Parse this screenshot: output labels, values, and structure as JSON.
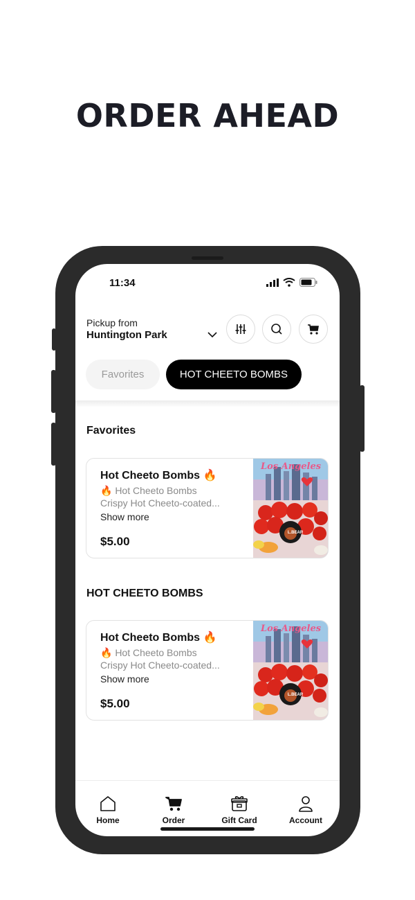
{
  "headline": "ORDER AHEAD",
  "status_bar": {
    "time": "11:34"
  },
  "header": {
    "pickup_label": "Pickup from",
    "location": "Huntington Park",
    "icons": [
      "filter-icon",
      "search-icon",
      "cart-icon"
    ]
  },
  "tabs": [
    {
      "label": "Favorites",
      "active": false
    },
    {
      "label": "HOT CHEETO BOMBS",
      "active": true
    }
  ],
  "sections": [
    {
      "title": "Favorites",
      "item": {
        "name": "Hot Cheeto Bombs 🔥",
        "subtitle": "🔥 Hot Cheeto Bombs",
        "description": "Crispy Hot Cheeto-coated...",
        "show_more": "Show more",
        "price": "$5.00",
        "image_text": "Los Angeles",
        "badge_text": "L.BEAR"
      }
    },
    {
      "title": "HOT CHEETO BOMBS",
      "item": {
        "name": "Hot Cheeto Bombs 🔥",
        "subtitle": "🔥 Hot Cheeto Bombs",
        "description": "Crispy Hot Cheeto-coated...",
        "show_more": "Show more",
        "price": "$5.00",
        "image_text": "Los Angeles",
        "badge_text": "L.BEAR"
      }
    }
  ],
  "bottom_nav": [
    {
      "label": "Home",
      "icon": "home-icon"
    },
    {
      "label": "Order",
      "icon": "cart-icon"
    },
    {
      "label": "Gift Card",
      "icon": "gift-card-icon"
    },
    {
      "label": "Account",
      "icon": "account-icon"
    }
  ],
  "colors": {
    "headline": "#1c1d26",
    "frame": "#2b2b2b",
    "accent": "#000000"
  }
}
